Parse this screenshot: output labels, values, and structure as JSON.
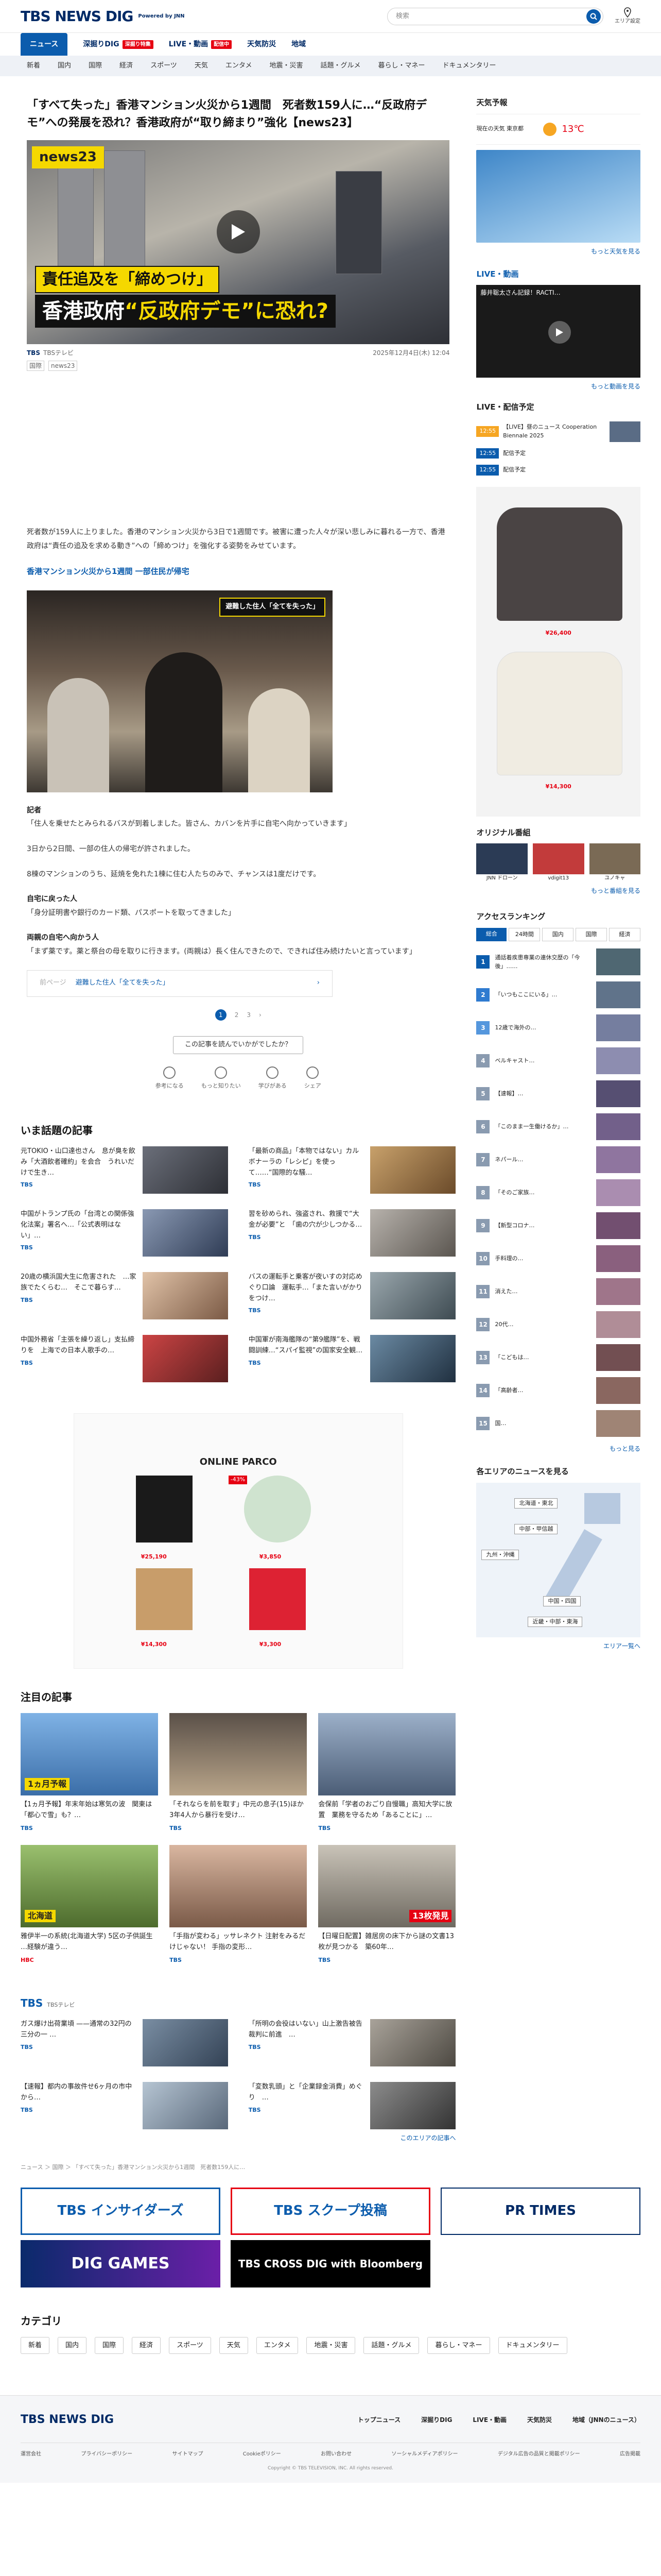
{
  "header": {
    "logo_main": "TBS NEWS DIG",
    "logo_sub": "Powered by JNN",
    "search_placeholder": "検索",
    "area_label": "エリア設定"
  },
  "gnav": [
    {
      "label": "ニュース",
      "active": true,
      "badge": ""
    },
    {
      "label": "深掘りDIG",
      "badge": "深掘り特集"
    },
    {
      "label": "LIVE・動画",
      "badge": "配信中"
    },
    {
      "label": "天気防災",
      "badge": ""
    },
    {
      "label": "地域",
      "badge": ""
    }
  ],
  "subnav": [
    "新着",
    "国内",
    "国際",
    "経済",
    "スポーツ",
    "天気",
    "エンタメ",
    "地震・災害",
    "話題・グルメ",
    "暮らし・マネー",
    "ドキュメンタリー"
  ],
  "article": {
    "title": "「すべて失った」香港マンション火災から1週間　死者数159人に…“反政府デモ”への発展を恐れ？香港政府が“取り締まり”強化【news23】",
    "hero_tag": "news23",
    "caption_1": "責任追及を「締めつけ」",
    "caption_2_a": "香港政府",
    "caption_2_b": "“反政府デモ”に恐れ?",
    "source": "TBSテレビ",
    "datetime": "2025年12月4日(木) 12:04",
    "tags": [
      "国際",
      "news23"
    ],
    "paragraphs": [
      "死者数が159人に上りました。香港のマンション火災から3日で1週間です。被害に遭った人々が深い悲しみに暮れる一方で、香港政府は“責任の追及を求める動き”への「締めつけ」を強化する姿勢をみせています。"
    ],
    "section_heading": "香港マンション火災から1週間 一部住民が帰宅",
    "photo_caption": "避難した住人「全てを失った」",
    "lines": [
      "記者",
      "「住人を乗せたとみられるバスが到着しました。皆さん、カバンを片手に自宅へ向かっていきます」",
      "3日から2日間、一部の住人の帰宅が許されました。",
      "8棟のマンションのうち、延焼を免れた1棟に住む人たちのみで、チャンスは1度だけです。",
      "自宅に戻った人",
      "「身分証明書や銀行のカード類、パスポートを取ってきました」",
      "両親の自宅へ向かう人",
      "「まず薬です。薬と祭台の母を取りに行きます。(両親は）長く住んできたので、できれば住み続けたいと言っています」"
    ],
    "pager_prev": "前ページ",
    "pager_next": "避難した住人「全てを失った」",
    "pages": [
      "1",
      "2",
      "3"
    ],
    "feedback": "この記事を読んでいかがでしたか？",
    "reactions": [
      "参考になる",
      "もっと知りたい",
      "学びがある",
      "シェア"
    ]
  },
  "popular": {
    "title": "いま話題の記事",
    "items": [
      {
        "text": "元TOKIO・山口達也さん　息が臭を飲み「大酒飲者確約」を会合　うれいだけで生き…",
        "src": "TBS"
      },
      {
        "text": "「最新の商品」「本物ではない」カルボナーラの「レシピ」を使って……“国際的な騒…",
        "src": "TBS"
      },
      {
        "text": "中国がトランプ氏の「台湾との関係強化法案」署名へ…「公式表明はない」…",
        "src": "TBS"
      },
      {
        "text": "習を砂められ、強盗され、救援で“大金が必要”と　「歯の穴が少しつかる…",
        "src": "TBS"
      },
      {
        "text": "20歳の横浜国大生に危害された　…家族でたくらむ…　そこで暮らす…",
        "src": "TBS"
      },
      {
        "text": "バスの運転手と乗客が夜いすの対応めぐり口論　運転手…「また言いがかりをつけ…",
        "src": "TBS"
      },
      {
        "text": "中国外務省「主張を繰り返し」支払締りを　上海での日本人歌手の…",
        "src": "TBS"
      },
      {
        "text": "中国軍が南海艦隊の“第9艦隊”を、戦闘訓練…“スパイ監視”の国家安全観…",
        "src": "TBS"
      }
    ]
  },
  "ad": {
    "brand": "ONLINE PARCO",
    "prices": [
      "¥25,190",
      "¥3,850",
      "¥14,300",
      "¥3,300"
    ],
    "discount": "-43%"
  },
  "featured": {
    "title": "注目の記事",
    "items": [
      {
        "text": "【1ヵ月予報】年末年始は寒気の波　関東は「都心で雪」も？…",
        "src": "TBS",
        "overlay": "1ヵ月予報"
      },
      {
        "text": "「それならを前を取す」中元の息子(15)ほか3年4人から暴行を受け…",
        "src": "TBS"
      },
      {
        "text": "会保前「学者のおごり自慢職」高知大学に放置　業務を守るため「あることに」…",
        "src": "TBS"
      },
      {
        "text": "雅伊半一の系統(北海道大学) 5区の子供誕生 …経験が違う…",
        "src": "HBC",
        "overlay": "北海道"
      },
      {
        "text": "「手指が変わる」ッサレネクト 注射をみるだけじゃない！ 手指の変形…",
        "src": "TBS"
      },
      {
        "text": "【日曜日配置】雑居房の床下から謎の文書13枚が見つかる　築60年…",
        "src": "TBS",
        "overlay": "13枚発見"
      }
    ]
  },
  "tbs_regional": {
    "title": "TBS",
    "sub": "TBSテレビ",
    "items": [
      {
        "text": "ガス爆け出荷業頃 ——通常の32円の三分の一 …",
        "src": "TBS"
      },
      {
        "text": "「所明の会役はいない」山上激告被告 裁判に前進　…",
        "src": "TBS"
      },
      {
        "text": "【速報】都内の事故件せ6ヶ月の市中から…",
        "src": "TBS"
      },
      {
        "text": "「変数乳頭」と「企業録金消費」めぐり　…",
        "src": "TBS"
      }
    ],
    "more": "このエリアの記事へ"
  },
  "breadcrumb": "ニュース ＞ 国際 ＞ 「すべて失った」香港マンション火災から1週間　死者数159人に…",
  "promos": [
    "TBS インサイダーズ",
    "TBS スクープ投稿",
    "PR TIMES",
    "DIG GAMES",
    "TBS CROSS DIG with Bloomberg"
  ],
  "categories": {
    "title": "カテゴリ",
    "items": [
      "新着",
      "国内",
      "国際",
      "経済",
      "スポーツ",
      "天気",
      "エンタメ",
      "地震・災害",
      "話題・グルメ",
      "暮らし・マネー",
      "ドキュメンタリー"
    ]
  },
  "side": {
    "weather_title": "天気予報",
    "weather_place": "現在の天気 東京都",
    "weather_temp": "13℃",
    "weather_more": "もっと天気を見る",
    "live_title": "LIVE・動画",
    "live_caption": "藤井聡太さん記録！RACTI…",
    "live_more": "もっと動画を見る",
    "schedule_title": "LIVE・配信予定",
    "schedule": [
      {
        "time": "12:55",
        "text": "【LIVE】昼のニュース Cooperation Biennale 2025"
      },
      {
        "time": "12:55",
        "text": "配信予定"
      },
      {
        "time": "12:55",
        "text": "配信予定"
      }
    ],
    "ad_prices": [
      "¥26,400",
      "¥14,300"
    ],
    "original_title": "オリジナル番組",
    "original": [
      "JNN ドローン",
      "vdigit13",
      "ユノキャ"
    ],
    "original_more": "もっと番組を見る",
    "ranking_title": "アクセスランキング",
    "ranking_tabs": [
      "総合",
      "24時間",
      "国内",
      "国際",
      "経済"
    ],
    "ranking": [
      "通話着疾患専業の連休交歴の「今後」……",
      "「いつもここにいる」…",
      "12歳で海外の…",
      "ベルキャスト…",
      "【速報】…",
      "「このまま一生働けるか」…",
      "ネパール…",
      "「そのご家族…",
      "【新型コロナ…",
      "手料理の…",
      "消えた…",
      "20代…",
      "「こどもは…",
      "「高齢者…",
      "国…"
    ],
    "ranking_more": "もっと見る",
    "area_title": "各エリアのニュースを見る",
    "areas": [
      "北海道・東北",
      "中部・甲信越",
      "九州・沖縄",
      "中国・四国",
      "近畿・中部・東海"
    ],
    "area_more": "エリア一覧へ"
  },
  "footer": {
    "logo": "TBS NEWS DIG",
    "nav": [
      "トップニュース",
      "深掘りDIG",
      "LIVE・動画",
      "天気防災",
      "地域（JNNのニュース）"
    ],
    "links": [
      "運営会社",
      "プライバシーポリシー",
      "サイトマップ",
      "Cookieポリシー",
      "お問い合わせ",
      "ソーシャルメディアポリシー",
      "デジタル広告の品質と掲載ポリシー",
      "広告掲載"
    ],
    "copyright": "Copyright © TBS TELEVISION, INC. All rights reserved."
  }
}
